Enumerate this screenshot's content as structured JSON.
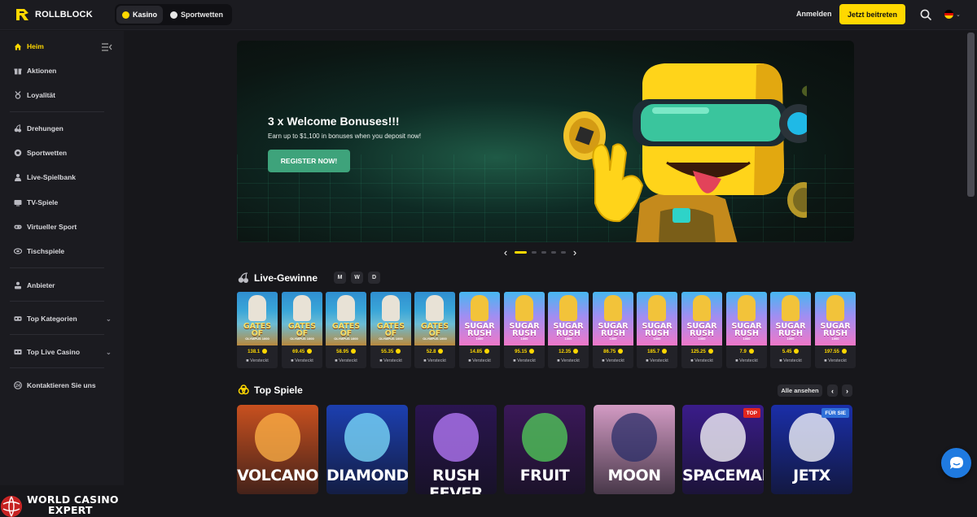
{
  "header": {
    "logo_text": "ROLLBLOCK",
    "modes": [
      {
        "label": "Kasino",
        "icon": "casino-icon",
        "active": true
      },
      {
        "label": "Sportwetten",
        "icon": "sports-ball-icon",
        "active": false
      }
    ],
    "login_label": "Anmelden",
    "join_label": "Jetzt beitreten",
    "search_icon": "search-icon",
    "language_icon": "german-flag-icon"
  },
  "sidebar": {
    "items": [
      {
        "label": "Heim",
        "icon": "home-icon",
        "active": true
      },
      {
        "label": "Aktionen",
        "icon": "gift-icon"
      },
      {
        "label": "Loyalität",
        "icon": "medal-icon"
      },
      {
        "label": "Drehungen",
        "icon": "cherries-icon"
      },
      {
        "label": "Sportwetten",
        "icon": "soccer-ball-icon"
      },
      {
        "label": "Live-Spielbank",
        "icon": "live-dealer-icon"
      },
      {
        "label": "TV-Spiele",
        "icon": "tv-icon"
      },
      {
        "label": "Virtueller Sport",
        "icon": "gamepad-icon"
      },
      {
        "label": "Tischspiele",
        "icon": "table-games-icon"
      },
      {
        "label": "Anbieter",
        "icon": "provider-icon"
      },
      {
        "label": "Top Kategorien",
        "icon": "categories-icon",
        "expandable": true
      },
      {
        "label": "Top Live Casino",
        "icon": "live-casino-icon",
        "expandable": true
      },
      {
        "label": "Kontaktieren Sie uns",
        "icon": "support-icon"
      }
    ],
    "watermark_line1": "WORLD CASINO",
    "watermark_line2": "EXPERT"
  },
  "hero": {
    "title": "3 x Welcome Bonuses!!!",
    "subtitle": "Earn up to $1,100 in bonuses when you deposit now!",
    "cta": "REGISTER NOW!",
    "slides": 5,
    "active_slide": 1
  },
  "live_wins": {
    "title": "Live-Gewinne",
    "filters": [
      "M",
      "W",
      "D"
    ],
    "items": [
      {
        "game": "GATES OF",
        "game_sub": "OLYMPUS 1000",
        "theme": "gates",
        "amount": "138.1",
        "user": "Versteckt"
      },
      {
        "game": "GATES OF",
        "game_sub": "OLYMPUS 1000",
        "theme": "gates",
        "amount": "69.45",
        "user": "Versteckt"
      },
      {
        "game": "GATES OF",
        "game_sub": "OLYMPUS 1000",
        "theme": "gates",
        "amount": "58.95",
        "user": "Versteckt"
      },
      {
        "game": "GATES OF",
        "game_sub": "OLYMPUS 1000",
        "theme": "gates",
        "amount": "55.35",
        "user": "Versteckt"
      },
      {
        "game": "GATES OF",
        "game_sub": "OLYMPUS 1000",
        "theme": "gates",
        "amount": "52.8",
        "user": "Versteckt"
      },
      {
        "game": "SUGAR RUSH",
        "game_sub": "1000",
        "theme": "sugar",
        "amount": "14.85",
        "user": "Versteckt"
      },
      {
        "game": "SUGAR RUSH",
        "game_sub": "1000",
        "theme": "sugar",
        "amount": "95.15",
        "user": "Versteckt"
      },
      {
        "game": "SUGAR RUSH",
        "game_sub": "1000",
        "theme": "sugar",
        "amount": "12.35",
        "user": "Versteckt"
      },
      {
        "game": "SUGAR RUSH",
        "game_sub": "1000",
        "theme": "sugar",
        "amount": "86.75",
        "user": "Versteckt"
      },
      {
        "game": "SUGAR RUSH",
        "game_sub": "1000",
        "theme": "sugar",
        "amount": "185.7",
        "user": "Versteckt"
      },
      {
        "game": "SUGAR RUSH",
        "game_sub": "1000",
        "theme": "sugar",
        "amount": "125.25",
        "user": "Versteckt"
      },
      {
        "game": "SUGAR RUSH",
        "game_sub": "1000",
        "theme": "sugar",
        "amount": "7.9",
        "user": "Versteckt"
      },
      {
        "game": "SUGAR RUSH",
        "game_sub": "1000",
        "theme": "sugar",
        "amount": "5.45",
        "user": "Versteckt"
      },
      {
        "game": "SUGAR RUSH",
        "game_sub": "1000",
        "theme": "sugar",
        "amount": "197.55",
        "user": "Versteckt"
      }
    ]
  },
  "top_games": {
    "title": "Top Spiele",
    "view_all": "Alle ansehen",
    "prev_icon": "chevron-left-icon",
    "next_icon": "chevron-right-icon",
    "items": [
      {
        "title": "VOLCANO",
        "badge": "",
        "bg": "#c8501f",
        "accent": "#ffb347"
      },
      {
        "title": "DIAMOND",
        "badge": "",
        "bg": "#1c3fb0",
        "accent": "#7fe2ff"
      },
      {
        "title": "RUSH FEVER",
        "badge": "",
        "bg": "#2a1550",
        "accent": "#b97cff"
      },
      {
        "title": "FRUIT",
        "badge": "",
        "bg": "#3a1858",
        "accent": "#52d05a"
      },
      {
        "title": "MOON",
        "badge": "",
        "bg": "#d39bc4",
        "accent": "#2a2d68"
      },
      {
        "title": "SPACEMAN",
        "badge": "TOP",
        "bg": "#3a1c8a",
        "accent": "#ffffff"
      },
      {
        "title": "JETX",
        "badge": "FÜR SIE",
        "bg": "#1a2ea8",
        "accent": "#ffffff"
      }
    ]
  },
  "colors": {
    "accent": "#ffd800",
    "cta_green": "#3ea37b",
    "chat": "#1f7ae0"
  }
}
